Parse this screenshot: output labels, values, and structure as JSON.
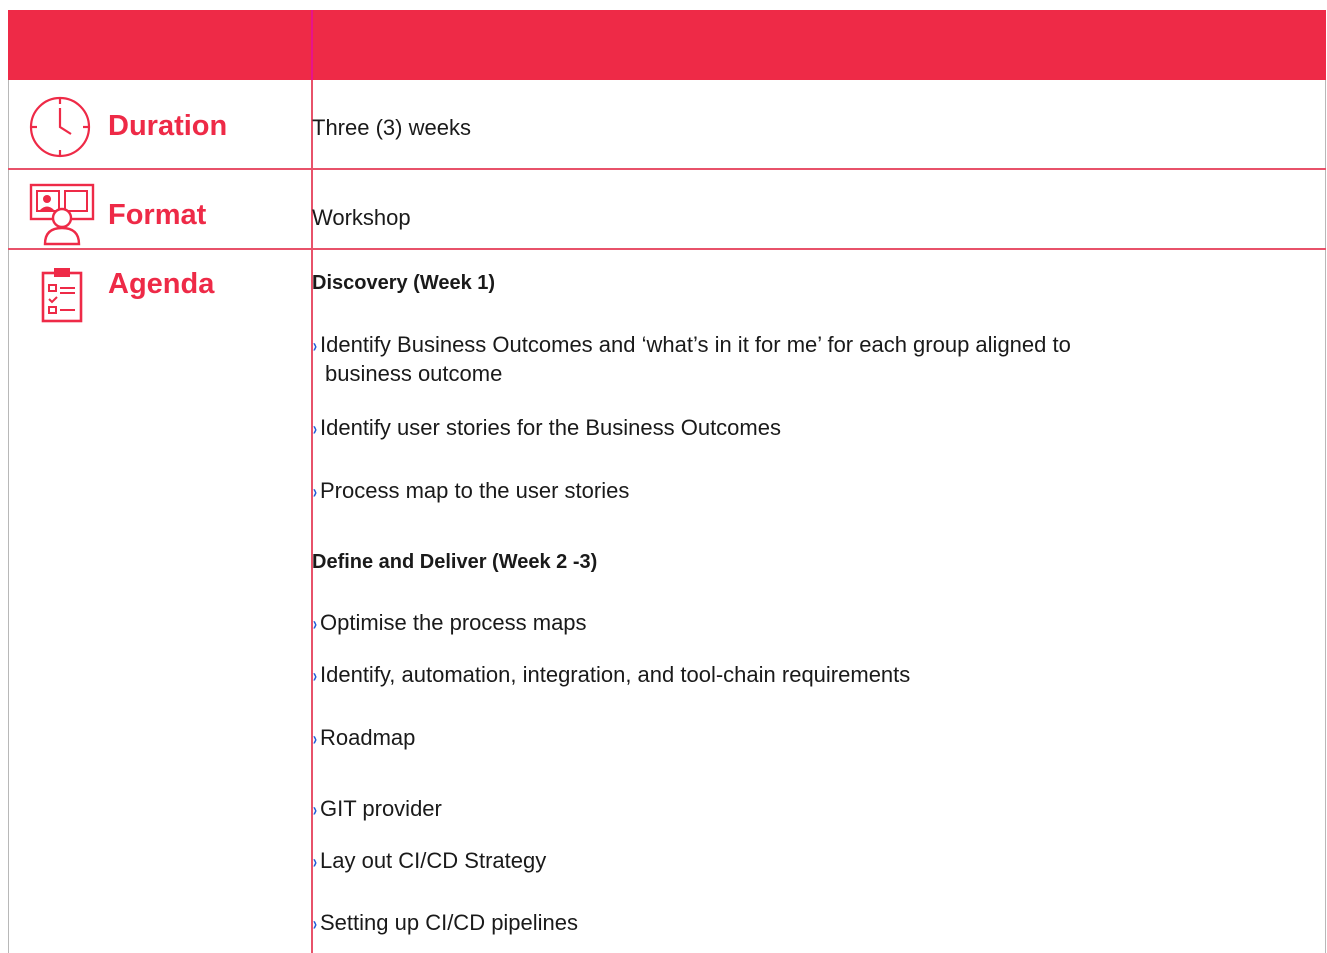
{
  "colors": {
    "accent": "#ee2a47",
    "divider": "#e8526a",
    "bullet": "#1f5bd8"
  },
  "rows": {
    "duration": {
      "label": "Duration",
      "value": "Three (3) weeks",
      "icon": "clock-icon"
    },
    "format": {
      "label": "Format",
      "value": "Workshop",
      "icon": "presentation-icon"
    },
    "agenda": {
      "label": "Agenda",
      "icon": "clipboard-checklist-icon"
    }
  },
  "agenda": {
    "discovery_title": "Discovery (Week 1)",
    "discovery_items": [
      "Identify Business Outcomes and ‘what’s in it for me’ for each group aligned to",
      "business outcome",
      "Identify user stories for the Business Outcomes",
      "Process map to the user stories"
    ],
    "define_title": "Define and Deliver (Week 2 -3)",
    "define_items": [
      "Optimise the process maps",
      "Identify, automation, integration, and tool-chain requirements",
      "Roadmap",
      "GIT provider",
      "Lay out CI/CD Strategy",
      "Setting up CI/CD pipelines"
    ]
  }
}
